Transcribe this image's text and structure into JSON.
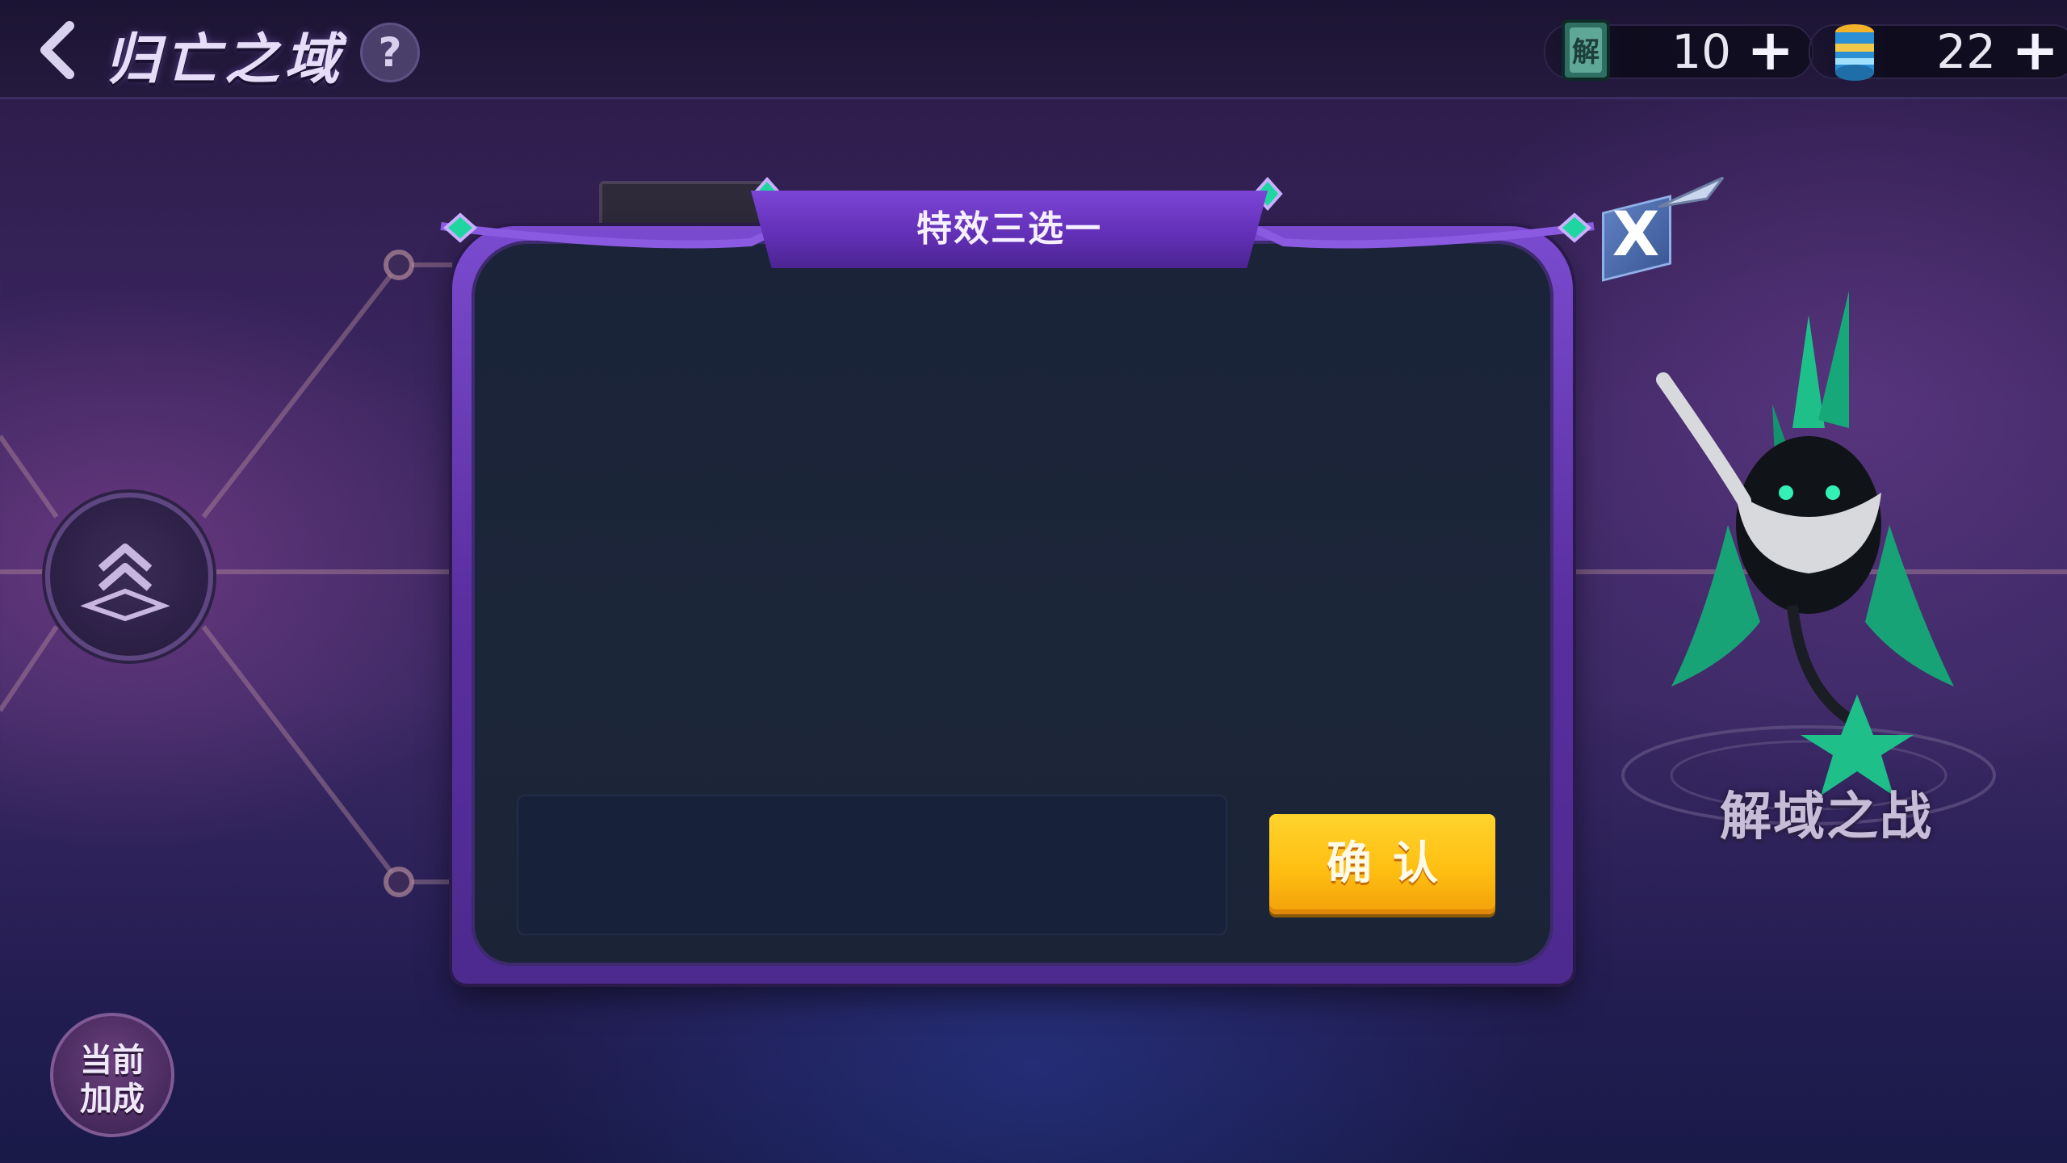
{
  "header": {
    "title": "归亡之域",
    "help_label": "?",
    "resources": [
      {
        "icon": "unlock-scroll-icon",
        "count": "10",
        "plus": "+"
      },
      {
        "icon": "energy-can-icon",
        "count": "22",
        "plus": "+"
      }
    ]
  },
  "modal": {
    "title": "特效三选一",
    "description": "",
    "confirm_label": "确认",
    "close_label": "X"
  },
  "side": {
    "boss_name": "解域之战",
    "bonus_line1": "当前",
    "bonus_line2": "加成"
  },
  "colors": {
    "accent_purple": "#6a36c4",
    "confirm_yellow": "#ffc21a",
    "panel_dark": "#1b2437"
  }
}
